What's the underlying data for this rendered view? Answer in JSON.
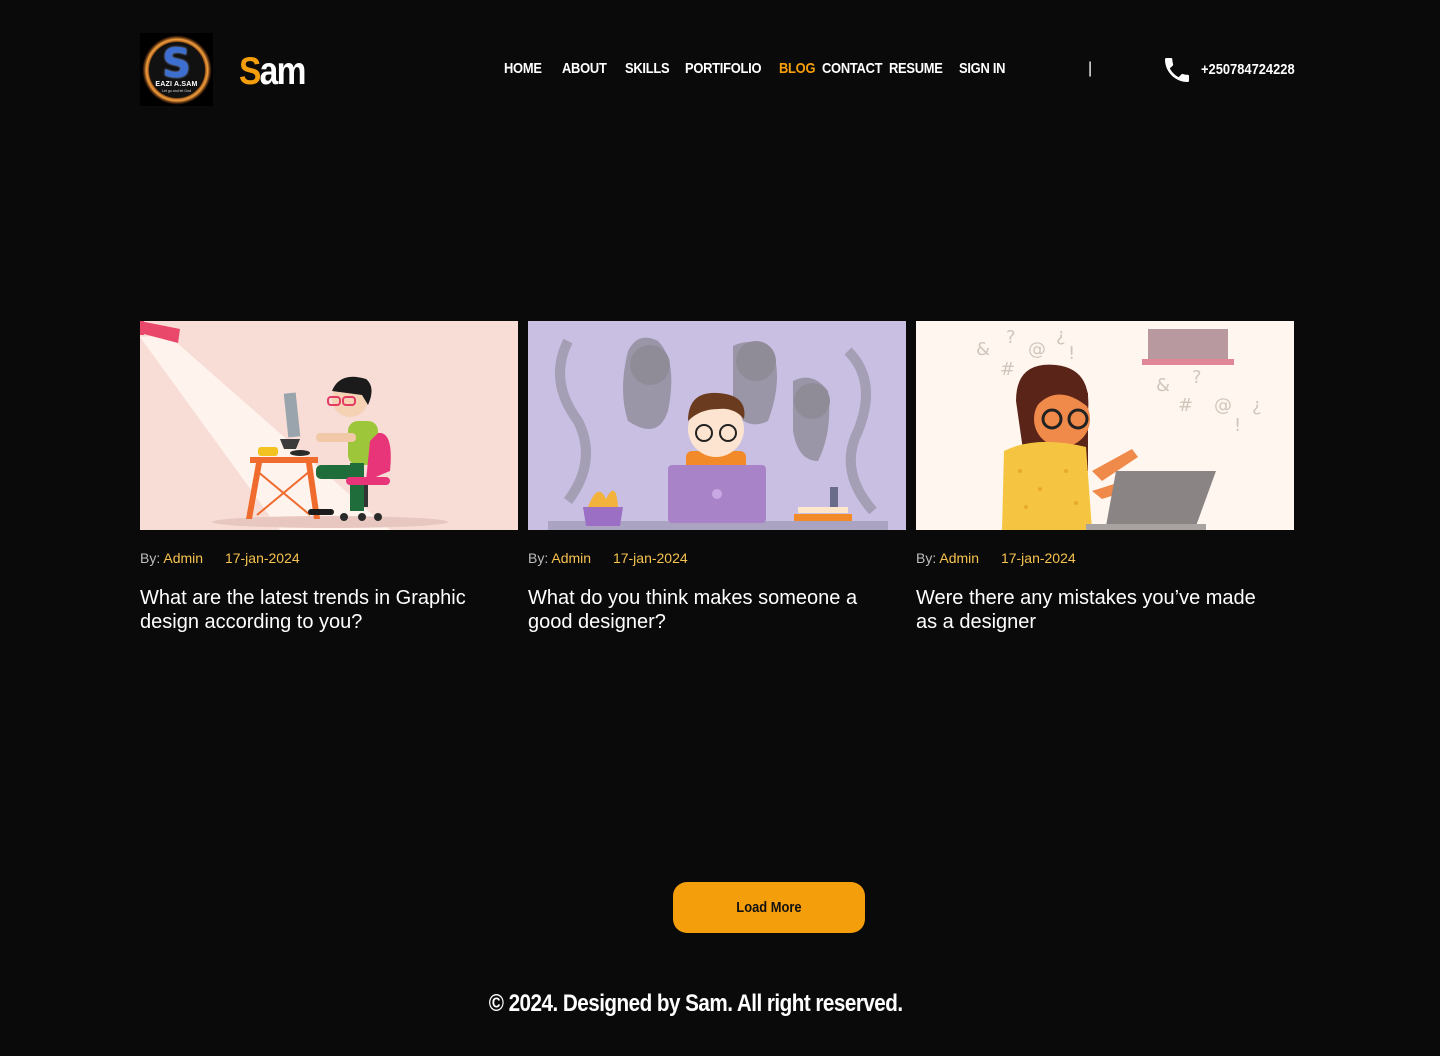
{
  "brand": {
    "logo_title": "EAZI A.SAM",
    "logo_subtitle": "Let go and let God",
    "name_initial": "S",
    "name_rest": "am"
  },
  "nav": {
    "items": [
      {
        "label": "HOME"
      },
      {
        "label": "ABOUT"
      },
      {
        "label": "SKILLS"
      },
      {
        "label": "PORTIFOLIO"
      },
      {
        "label": "BLOG",
        "active": true
      },
      {
        "label": "CONTACT"
      },
      {
        "label": "RESUME"
      },
      {
        "label": "SIGN IN"
      }
    ],
    "separator": "|"
  },
  "contact": {
    "phone": "+250784724228",
    "icon": "phone-icon"
  },
  "posts": [
    {
      "by_label": "By:",
      "author": "Admin",
      "date": "17-jan-2024",
      "title": "What are the latest trends in Graphic design according to you?",
      "image": "designer-at-desk-illustration"
    },
    {
      "by_label": "By:",
      "author": "Admin",
      "date": "17-jan-2024",
      "title": "What do you think makes someone a good designer?",
      "image": "designer-with-ghosts-illustration"
    },
    {
      "by_label": "By:",
      "author": "Admin",
      "date": "17-jan-2024",
      "title": "Were there any mistakes you’ve made as a designer",
      "image": "frustrated-designer-illustration"
    }
  ],
  "load_more": "Load More",
  "footer": "© 2024. Designed by Sam. All right reserved.",
  "colors": {
    "background": "#0a0a0a",
    "accent": "#f59e0b",
    "meta_accent": "#f6c350"
  }
}
